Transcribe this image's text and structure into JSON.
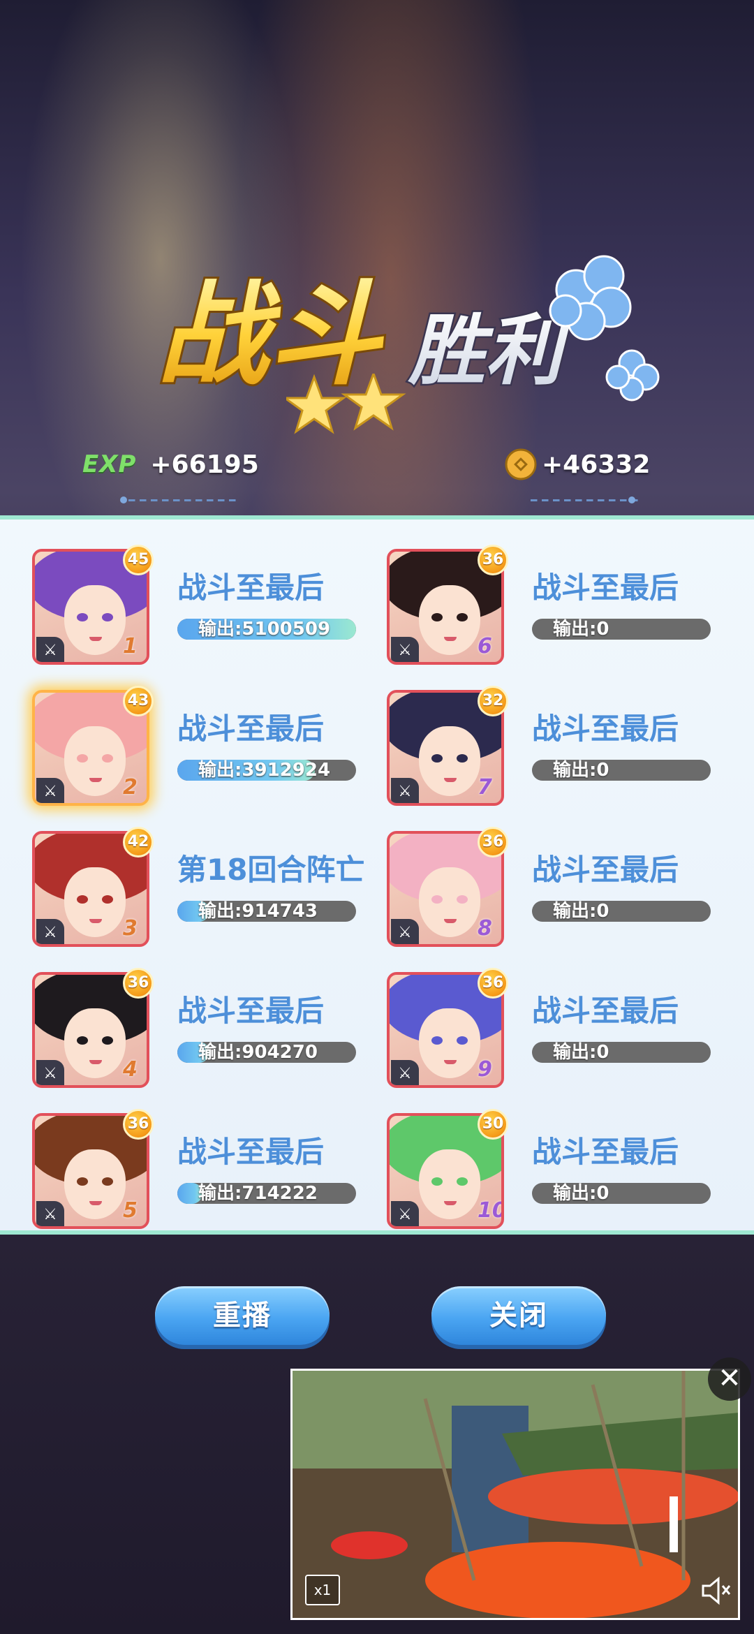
{
  "title": {
    "main": "战斗",
    "sub": "胜利"
  },
  "rewards": {
    "exp_label": "EXP",
    "exp_value": "+66195",
    "gold_value": "+46332"
  },
  "heroes": [
    {
      "level": "45",
      "slot": "1",
      "status": "战斗至最后",
      "damage": "输出:5100509",
      "damage_fraction": 1.0,
      "hair": "#7b4bbf",
      "highlight": false,
      "slot_color": "#e07a30"
    },
    {
      "level": "36",
      "slot": "6",
      "status": "战斗至最后",
      "damage": "输出:0",
      "damage_fraction": 0.0,
      "hair": "#2a1a1a",
      "highlight": false,
      "slot_color": "#9b5ad6"
    },
    {
      "level": "43",
      "slot": "2",
      "status": "战斗至最后",
      "damage": "输出:3912924",
      "damage_fraction": 0.77,
      "hair": "#f4a6a6",
      "highlight": true,
      "slot_color": "#e07a30"
    },
    {
      "level": "32",
      "slot": "7",
      "status": "战斗至最后",
      "damage": "输出:0",
      "damage_fraction": 0.0,
      "hair": "#2c2a4e",
      "highlight": false,
      "slot_color": "#9b5ad6"
    },
    {
      "level": "42",
      "slot": "3",
      "status": "第18回合阵亡",
      "damage": "输出:914743",
      "damage_fraction": 0.18,
      "hair": "#b0302c",
      "highlight": false,
      "slot_color": "#e07a30"
    },
    {
      "level": "36",
      "slot": "8",
      "status": "战斗至最后",
      "damage": "输出:0",
      "damage_fraction": 0.0,
      "hair": "#f3b1c3",
      "highlight": false,
      "slot_color": "#9b5ad6"
    },
    {
      "level": "36",
      "slot": "4",
      "status": "战斗至最后",
      "damage": "输出:904270",
      "damage_fraction": 0.18,
      "hair": "#1e1a1e",
      "highlight": false,
      "slot_color": "#e07a30"
    },
    {
      "level": "36",
      "slot": "9",
      "status": "战斗至最后",
      "damage": "输出:0",
      "damage_fraction": 0.0,
      "hair": "#5a5ad0",
      "highlight": false,
      "slot_color": "#9b5ad6"
    },
    {
      "level": "36",
      "slot": "5",
      "status": "战斗至最后",
      "damage": "输出:714222",
      "damage_fraction": 0.14,
      "hair": "#7a3a1e",
      "highlight": false,
      "slot_color": "#e07a30"
    },
    {
      "level": "30",
      "slot": "10",
      "status": "战斗至最后",
      "damage": "输出:0",
      "damage_fraction": 0.0,
      "hair": "#5ec86a",
      "highlight": false,
      "slot_color": "#9b5ad6"
    }
  ],
  "buttons": {
    "replay": "重播",
    "close": "关闭"
  },
  "ad": {
    "speed": "x1",
    "close_icon": "close-icon",
    "volume_icon": "volume-icon"
  },
  "colors": {
    "status_text": "#4d8fd9",
    "badge": "#f59a18",
    "button": "#4aa5f2"
  }
}
